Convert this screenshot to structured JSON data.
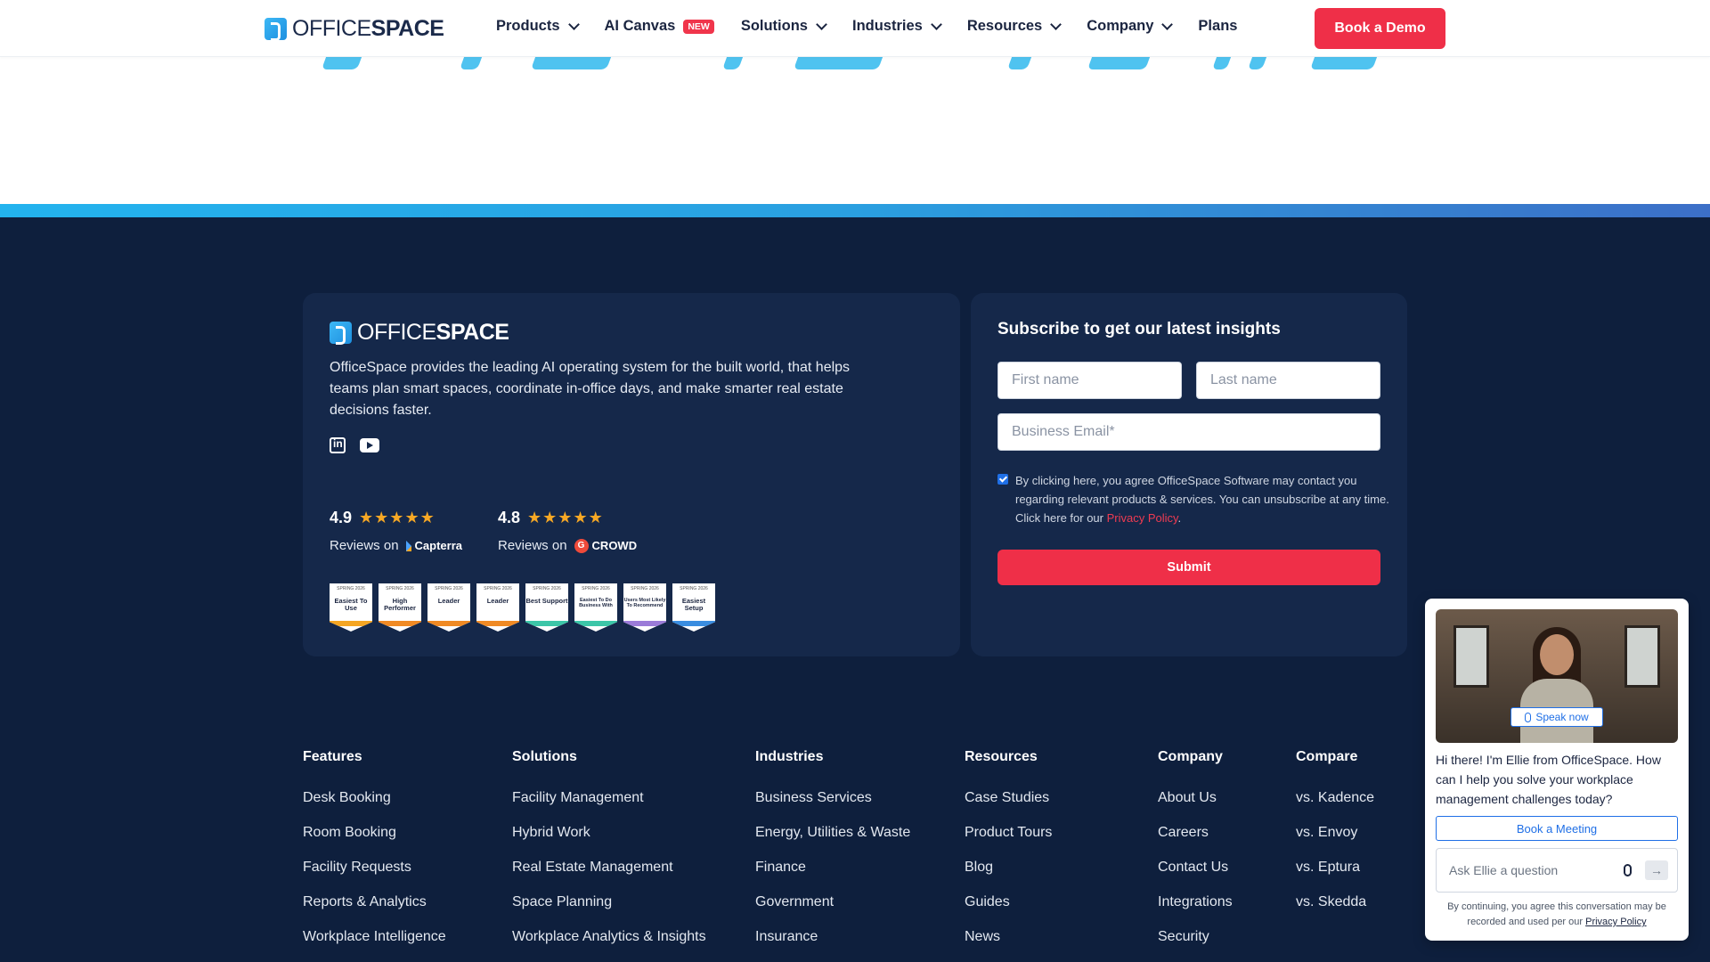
{
  "header": {
    "logo": {
      "light": "OFFICE",
      "bold": "SPACE"
    },
    "nav": [
      {
        "label": "Products",
        "dropdown": true
      },
      {
        "label": "AI Canvas",
        "badge": "NEW"
      },
      {
        "label": "Solutions",
        "dropdown": true
      },
      {
        "label": "Industries",
        "dropdown": true
      },
      {
        "label": "Resources",
        "dropdown": true
      },
      {
        "label": "Company",
        "dropdown": true
      },
      {
        "label": "Plans"
      }
    ],
    "cta": "Book a Demo"
  },
  "colors": {
    "accent": "#ef2f48",
    "footer_bg": "#0e1f3d",
    "card_bg": "#15284a",
    "link_blue": "#1f6fe6",
    "star": "#f7a825"
  },
  "about": {
    "logo": {
      "light": "OFFICE",
      "bold": "SPACE"
    },
    "description": "OfficeSpace provides the leading AI operating system for the built world, that helps teams plan smart spaces, coordinate in-office days, and make smarter real estate decisions faster.",
    "social_icons": [
      "linkedin-icon",
      "youtube-icon"
    ]
  },
  "ratings": [
    {
      "score": "4.9",
      "stars": "★★★★★",
      "prefix": "Reviews on",
      "brand": "Capterra"
    },
    {
      "score": "4.8",
      "stars": "★★★★★",
      "prefix": "Reviews on",
      "brand": "CROWD"
    }
  ],
  "g2_badges": [
    {
      "season": "SPRING 2026",
      "label": "Easiest To Use",
      "color": "#f5a623"
    },
    {
      "season": "SPRING 2026",
      "label": "High Performer",
      "color": "#f08a24"
    },
    {
      "season": "SPRING 2026",
      "label": "Leader",
      "color": "#f08a24"
    },
    {
      "season": "SPRING 2026",
      "label": "Leader",
      "color": "#f08a24"
    },
    {
      "season": "SPRING 2026",
      "label": "Best Support",
      "color": "#3cc6a8"
    },
    {
      "season": "SPRING 2026",
      "label": "Easiest To Do Business With",
      "color": "#3cc6a8"
    },
    {
      "season": "SPRING 2026",
      "label": "Users Most Likely To Recommend",
      "color": "#9b7bd8"
    },
    {
      "season": "SPRING 2026",
      "label": "Easiest Setup",
      "color": "#3a8de0"
    }
  ],
  "subscribe": {
    "title": "Subscribe to get our latest insights",
    "first_name_placeholder": "First name",
    "last_name_placeholder": "Last name",
    "email_placeholder": "Business Email*",
    "consent_text": "By clicking here, you agree OfficeSpace Software may contact you regarding relevant products & services. You can unsubscribe at any time. Click here for our ",
    "privacy_link": "Privacy Policy",
    "consent_end": ".",
    "consent_checked": true,
    "submit": "Submit"
  },
  "columns": [
    {
      "title": "Features",
      "links": [
        "Desk Booking",
        "Room Booking",
        "Facility Requests",
        "Reports & Analytics",
        "Workplace Intelligence"
      ]
    },
    {
      "title": "Solutions",
      "links": [
        "Facility Management",
        "Hybrid Work",
        "Real Estate Management",
        "Space Planning",
        "Workplace Analytics & Insights"
      ]
    },
    {
      "title": "Industries",
      "links": [
        "Business Services",
        "Energy, Utilities & Waste",
        "Finance",
        "Government",
        "Insurance"
      ]
    },
    {
      "title": "Resources",
      "links": [
        "Case Studies",
        "Product Tours",
        "Blog",
        "Guides",
        "News"
      ]
    },
    {
      "title": "Company",
      "links": [
        "About Us",
        "Careers",
        "Contact Us",
        "Integrations",
        "Security"
      ]
    },
    {
      "title": "Compare",
      "links": [
        "vs. Kadence",
        "vs. Envoy",
        "vs. Eptura",
        "vs. Skedda"
      ]
    }
  ],
  "chat": {
    "speak_now": "Speak now",
    "message": "Hi there! I'm Ellie from OfficeSpace. How can I help you solve your workplace management challenges today?",
    "book_meeting": "Book a Meeting",
    "input_placeholder": "Ask Ellie a question",
    "legal": "By continuing, you agree this conversation may be recorded and used per our ",
    "legal_link": "Privacy Policy"
  }
}
